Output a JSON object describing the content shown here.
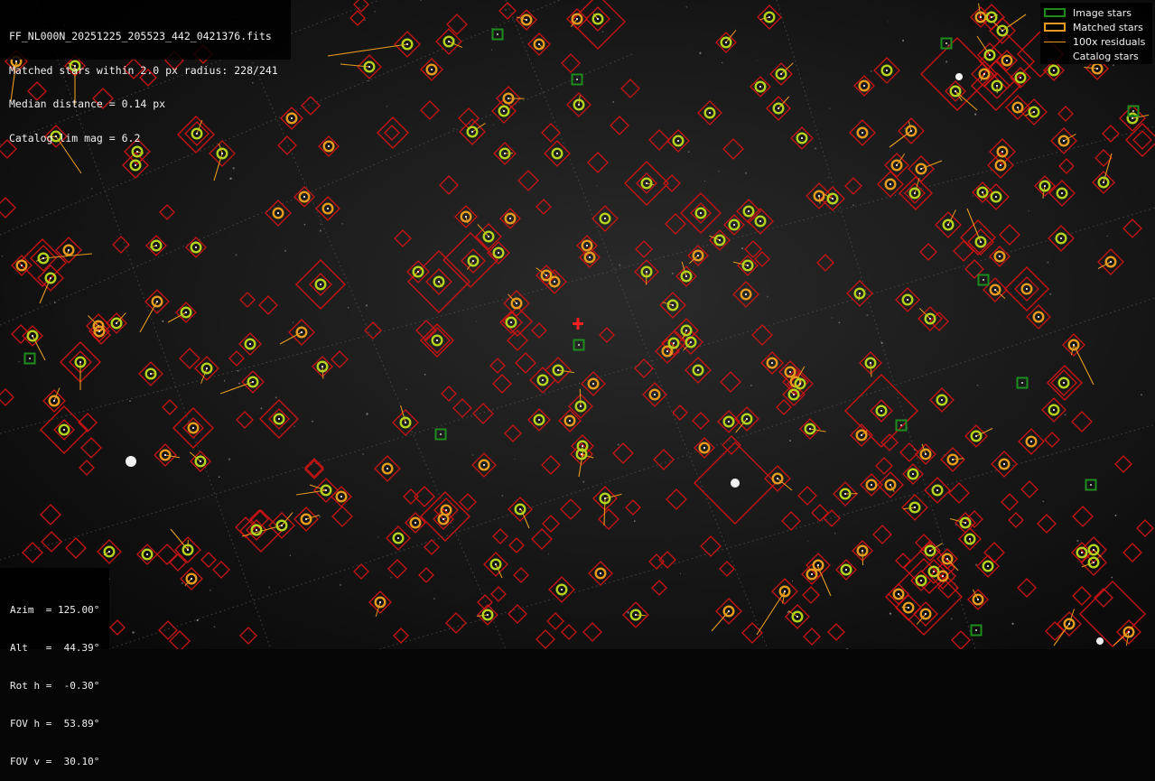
{
  "info": {
    "filename": "FF_NL000N_20251225_205523_442_0421376.fits",
    "matched_line": "Matched stars within 2.0 px radius: 228/241",
    "median_line": "Median distance = 0.14 px",
    "limmag_line": "Catalog lim mag = 6.2"
  },
  "legend": {
    "image_stars": "Image stars",
    "matched_stars": "Matched stars",
    "residuals": "100x residuals",
    "catalog_stars": "Catalog stars"
  },
  "pointing": {
    "azim": "Azim  = 125.00°",
    "alt": "Alt   =  44.39°",
    "rot": "Rot h =  -0.30°",
    "fov_h": "FOV h =  53.89°",
    "fov_v": "FOV v =  30.10°"
  },
  "colors": {
    "image_star": "#1e8c1e",
    "matched_ring": "#e69b1e",
    "matched_green": "#b4d21e",
    "catalog": "#c81414",
    "residual": "#e69b1e",
    "center_marker": "#ff1e1e",
    "grid": "#5a5a5a"
  }
}
